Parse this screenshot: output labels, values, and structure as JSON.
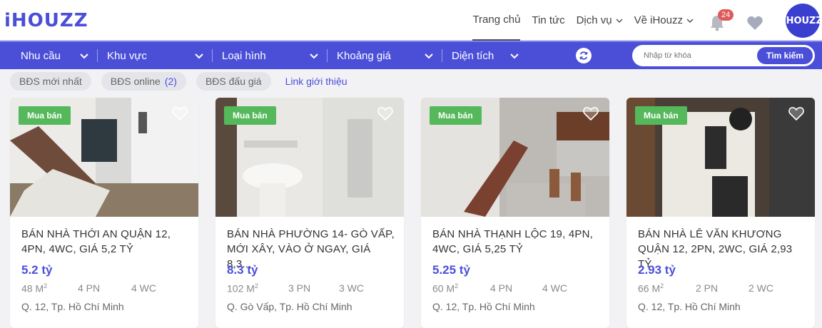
{
  "logo": "iHOUZZ",
  "nav": {
    "items": [
      {
        "label": "Trang chủ",
        "caret": false,
        "active": true
      },
      {
        "label": "Tin tức",
        "caret": false,
        "active": false
      },
      {
        "label": "Dịch vụ",
        "caret": true,
        "active": false
      },
      {
        "label": "Về iHouzz",
        "caret": true,
        "active": false
      }
    ],
    "notification_count": "24",
    "avatar_text": "iHOUZZ"
  },
  "filters": {
    "items": [
      "Nhu cầu",
      "Khu vực",
      "Loại hình",
      "Khoảng giá",
      "Diện tích"
    ],
    "search_placeholder": "Nhập từ khóa",
    "search_button": "Tìm kiếm"
  },
  "chips": {
    "newest": "BĐS mới nhất",
    "online": "BĐS online",
    "online_count": "(2)",
    "auction": "BĐS đấu giá",
    "intro_link": "Link giới thiệu"
  },
  "listings": [
    {
      "tag": "Mua bán",
      "title": "BÁN NHÀ THỚI AN QUẬN 12, 4PN, 4WC, GIÁ 5,2 TỶ",
      "price": "5.2 tỷ",
      "area": "48 M",
      "beds": "4 PN",
      "baths": "4 WC",
      "location": "Q. 12, Tp. Hồ Chí Minh"
    },
    {
      "tag": "Mua bán",
      "title": "BÁN NHÀ PHƯỜNG 14- GÒ VẤP, MỚI XÂY, VÀO Ở NGAY, GIÁ 8,3...",
      "price": "8.3 tỷ",
      "area": "102 M",
      "beds": "3 PN",
      "baths": "3 WC",
      "location": "Q. Gò Vấp, Tp. Hồ Chí Minh"
    },
    {
      "tag": "Mua bán",
      "title": "BÁN NHÀ THẠNH LỘC 19, 4PN, 4WC, GIÁ 5,25 TỶ",
      "price": "5.25 tỷ",
      "area": "60 M",
      "beds": "4 PN",
      "baths": "4 WC",
      "location": "Q. 12, Tp. Hồ Chí Minh"
    },
    {
      "tag": "Mua bán",
      "title": "BÁN NHÀ LÊ VĂN KHƯƠNG QUẬN 12, 2PN, 2WC, GIÁ 2,93 TỶ",
      "price": "2.93 tỷ",
      "area": "66 M",
      "beds": "2 PN",
      "baths": "2 WC",
      "location": "Q. 12, Tp. Hồ Chí Minh"
    }
  ],
  "area_unit_sup": "2",
  "colors": {
    "brand": "#4b4fd8",
    "tag_green": "#55b85b",
    "badge_red": "#e05a5a"
  }
}
